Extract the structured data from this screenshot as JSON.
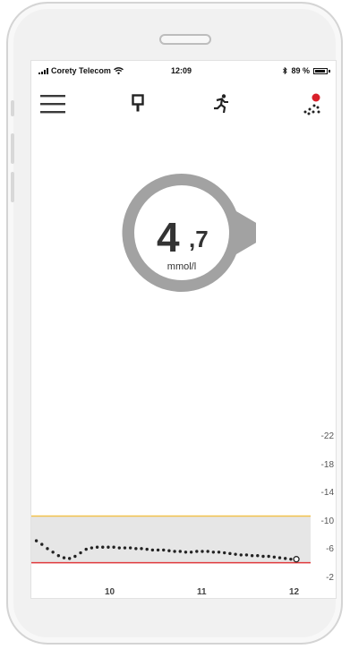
{
  "status_bar": {
    "carrier": "Corety Telecom",
    "time": "12:09",
    "battery": "89 %"
  },
  "toolbar": {
    "menu_icon": "hamburger-menu-icon",
    "sensor_icon": "sensor-icon",
    "activity_icon": "running-person-icon",
    "alerts_icon": "dots-alert-icon"
  },
  "glucose": {
    "integer": "4",
    "decimal": ",7",
    "unit": "mmol/l",
    "trend": "flat"
  },
  "chart_data": {
    "type": "scatter",
    "x_ticks": [
      "10",
      "11",
      "12"
    ],
    "y_ticks": [
      "22",
      "18",
      "14",
      "10",
      "6",
      "2"
    ],
    "ylim": [
      2,
      22
    ],
    "target_range": [
      4.2,
      10.8
    ],
    "high_line": 10.8,
    "low_line": 4.2,
    "series": [
      {
        "x": [
          9.2,
          9.26,
          9.32,
          9.38,
          9.44,
          9.5,
          9.56,
          9.62,
          9.68,
          9.74,
          9.8,
          9.86,
          9.92,
          9.98,
          10.04,
          10.1,
          10.16,
          10.22,
          10.28,
          10.34,
          10.4,
          10.46,
          10.52,
          10.58,
          10.64,
          10.7,
          10.76,
          10.82,
          10.88,
          10.94,
          11.0,
          11.06,
          11.12,
          11.18,
          11.24,
          11.3,
          11.36,
          11.42,
          11.48,
          11.54,
          11.6,
          11.66,
          11.72,
          11.78,
          11.84,
          11.9,
          11.96,
          12.02
        ],
        "values": [
          7.3,
          6.8,
          6.2,
          5.7,
          5.2,
          4.9,
          4.8,
          5.1,
          5.6,
          6.1,
          6.3,
          6.4,
          6.4,
          6.4,
          6.4,
          6.3,
          6.3,
          6.3,
          6.2,
          6.2,
          6.1,
          6.0,
          6.0,
          6.0,
          5.9,
          5.8,
          5.8,
          5.7,
          5.7,
          5.8,
          5.8,
          5.8,
          5.7,
          5.7,
          5.6,
          5.5,
          5.4,
          5.3,
          5.3,
          5.2,
          5.2,
          5.1,
          5.1,
          5.0,
          4.9,
          4.8,
          4.7,
          4.7
        ]
      }
    ]
  },
  "colors": {
    "high_line": "#f2c24b",
    "low_line": "#e0393b",
    "target_band": "#e6e6e6",
    "gauge_ring": "#a2a2a2",
    "alert_dot": "#d9202a"
  }
}
